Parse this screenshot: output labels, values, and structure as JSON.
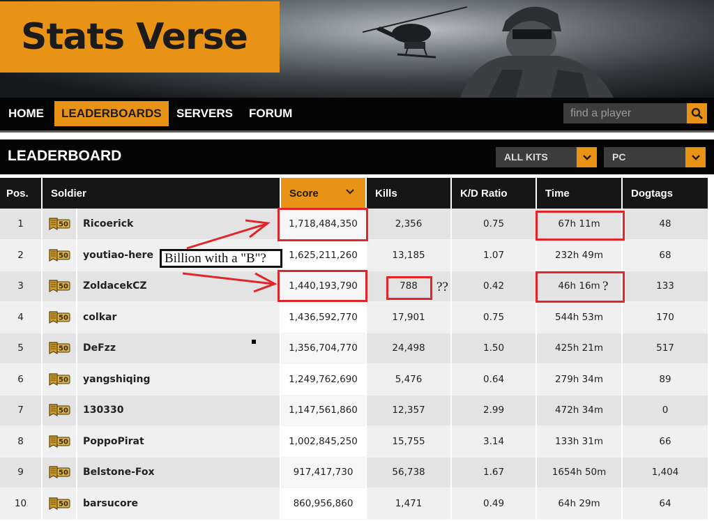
{
  "site": {
    "logo": "Stats Verse"
  },
  "nav": {
    "items": [
      "HOME",
      "LEADERBOARDS",
      "SERVERS",
      "FORUM"
    ],
    "active": "LEADERBOARDS",
    "search_placeholder": "find a player"
  },
  "leaderboard": {
    "title": "LEADERBOARD",
    "kits_filter": "ALL KITS",
    "platform_filter": "PC",
    "columns": [
      "Pos.",
      "Soldier",
      "Score",
      "Kills",
      "K/D Ratio",
      "Time",
      "Dogtags"
    ],
    "sorted_by": "Score",
    "rows": [
      {
        "pos": "1",
        "soldier": "Ricoerick",
        "score": "1,718,484,350",
        "kills": "2,356",
        "kd": "0.75",
        "time": "67h 11m",
        "dogtags": "48"
      },
      {
        "pos": "2",
        "soldier": "youtiao-here",
        "score": "1,625,211,260",
        "kills": "13,185",
        "kd": "1.07",
        "time": "232h 49m",
        "dogtags": "68"
      },
      {
        "pos": "3",
        "soldier": "ZoldacekCZ",
        "score": "1,440,193,790",
        "kills": "788",
        "kd": "0.42",
        "time": "46h 16m",
        "dogtags": "133"
      },
      {
        "pos": "4",
        "soldier": "colkar",
        "score": "1,436,592,770",
        "kills": "17,901",
        "kd": "0.75",
        "time": "544h 53m",
        "dogtags": "170"
      },
      {
        "pos": "5",
        "soldier": "DeFzz",
        "score": "1,356,704,770",
        "kills": "24,498",
        "kd": "1.50",
        "time": "425h 21m",
        "dogtags": "517"
      },
      {
        "pos": "6",
        "soldier": "yangshiqing",
        "score": "1,249,762,690",
        "kills": "5,476",
        "kd": "0.64",
        "time": "279h 34m",
        "dogtags": "89"
      },
      {
        "pos": "7",
        "soldier": "130330",
        "score": "1,147,561,860",
        "kills": "12,357",
        "kd": "2.99",
        "time": "472h 34m",
        "dogtags": "0"
      },
      {
        "pos": "8",
        "soldier": "PoppoPirat",
        "score": "1,002,845,250",
        "kills": "15,755",
        "kd": "3.14",
        "time": "133h 31m",
        "dogtags": "66"
      },
      {
        "pos": "9",
        "soldier": "Belstone-Fox",
        "score": "917,417,730",
        "kills": "56,738",
        "kd": "1.67",
        "time": "1654h 50m",
        "dogtags": "1,404"
      },
      {
        "pos": "10",
        "soldier": "barsucore",
        "score": "860,956,860",
        "kills": "1,471",
        "kd": "0.49",
        "time": "64h 29m",
        "dogtags": "64"
      }
    ],
    "rank_badge": "50"
  },
  "annotations": {
    "label": "Billion with a \"B\"?",
    "kills_question": "??",
    "time_question": "?"
  },
  "colors": {
    "accent": "#e89315",
    "annotation_red": "#e0262b",
    "nav_bg": "#050505"
  }
}
